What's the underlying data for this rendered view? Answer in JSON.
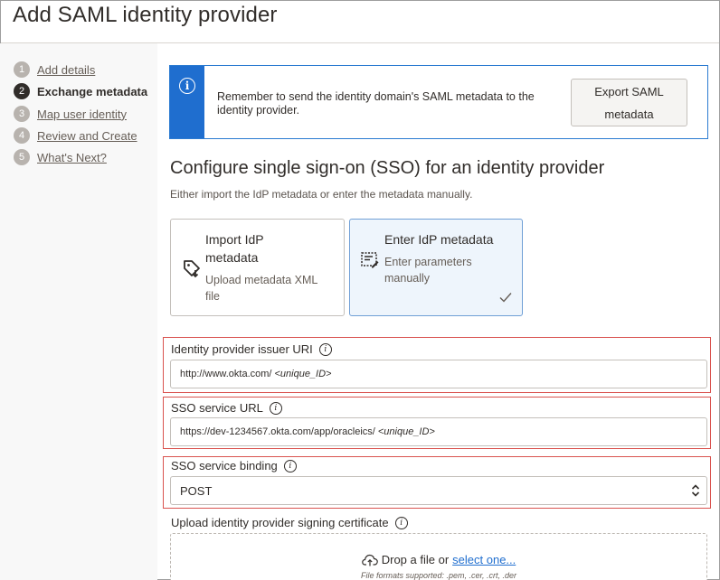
{
  "page": {
    "title": "Add SAML identity provider"
  },
  "steps": [
    {
      "num": "1",
      "label": "Add details"
    },
    {
      "num": "2",
      "label": "Exchange metadata",
      "active": true
    },
    {
      "num": "3",
      "label": "Map user identity"
    },
    {
      "num": "4",
      "label": "Review and Create"
    },
    {
      "num": "5",
      "label": "What's Next?"
    }
  ],
  "banner": {
    "message": "Remember to send the identity domain's SAML metadata to the identity provider.",
    "button_line1": "Export SAML",
    "button_line2": "metadata"
  },
  "section": {
    "title": "Configure single sign-on (SSO) for an identity provider",
    "subtitle": "Either import the IdP metadata or enter the metadata manually."
  },
  "options": [
    {
      "title_line1": "Import IdP",
      "title_line2": "metadata",
      "desc_line1": "Upload metadata XML",
      "desc_line2": "file",
      "icon": "tag-download-icon",
      "selected": false
    },
    {
      "title_line1": "Enter IdP metadata",
      "desc_line1": "Enter parameters",
      "desc_line2": "manually",
      "icon": "edit-form-icon",
      "selected": true
    }
  ],
  "fields": {
    "issuer": {
      "label": "Identity provider issuer URI",
      "value": "http://www.okta.com/",
      "value_italic": "<unique_ID>"
    },
    "sso_url": {
      "label": "SSO service URL",
      "value": "https://dev-1234567.okta.com/app/oracleics/",
      "value_italic": "<unique_ID>"
    },
    "binding": {
      "label": "SSO service binding",
      "value": "POST"
    },
    "certificate": {
      "label": "Upload identity provider signing certificate"
    }
  },
  "upload": {
    "drop_text": "Drop a file or",
    "link_text": "select one...",
    "formats": "File formats supported: .pem, .cer, .crt, .der"
  },
  "colors": {
    "accent": "#1f6ecf",
    "highlight": "#d9534f"
  }
}
